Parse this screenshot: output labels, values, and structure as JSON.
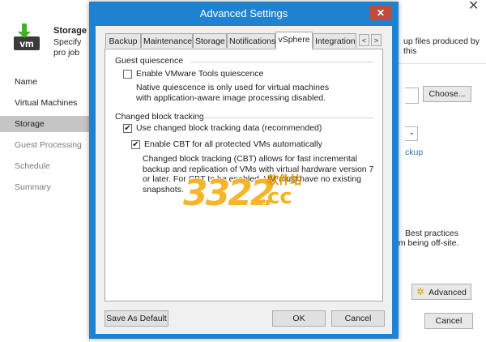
{
  "wizard": {
    "title": "Storage",
    "description_left": "Specify pro job and cu",
    "description_right": "up files produced by this",
    "close_glyph": "✕",
    "nav": [
      {
        "label": "Name",
        "state": "normal"
      },
      {
        "label": "Virtual Machines",
        "state": "normal"
      },
      {
        "label": "Storage",
        "state": "active"
      },
      {
        "label": "Guest Processing",
        "state": "dim"
      },
      {
        "label": "Schedule",
        "state": "dim"
      },
      {
        "label": "Summary",
        "state": "dim"
      }
    ],
    "choose_label": "Choose...",
    "link_fragment": "ckup",
    "note_line1": "Best practices",
    "note_line2": "em being off-site.",
    "advanced_label": "Advanced",
    "cancel_label": "Cancel",
    "icon": "vm-wizard-icon",
    "icon_text": "vm",
    "colors": {
      "nav_active": "#c5c5c5",
      "link": "#2a6fc0"
    }
  },
  "dialog": {
    "title": "Advanced Settings",
    "close_glyph": "✕",
    "tabs": [
      "Backup",
      "Maintenance",
      "Storage",
      "Notifications",
      "vSphere",
      "Integration"
    ],
    "active_tab": "vSphere",
    "tab_scroll_left": "<",
    "tab_scroll_right": ">",
    "guest_quiescence": {
      "heading": "Guest quiescence",
      "checkbox_label": "Enable VMware Tools quiescence",
      "checked": false,
      "help": "Native quiescence is only used for virtual machines with application-aware image processing disabled."
    },
    "cbt": {
      "heading": "Changed block tracking",
      "use_cbt_label": "Use changed block tracking data (recommended)",
      "use_cbt_checked": true,
      "enable_cbt_label": "Enable CBT for all protected VMs automatically",
      "enable_cbt_checked": true,
      "help": "Changed block tracking (CBT) allows for fast incremental backup and replication of VMs with virtual hardware version 7 or later. For CBT to be enabled, VM must have no existing snapshots."
    },
    "buttons": {
      "save_default": "Save As Default",
      "ok": "OK",
      "cancel": "Cancel"
    },
    "colors": {
      "titlebar": "#1e82d0",
      "close": "#c44a3c"
    }
  },
  "watermark": {
    "digits": "3322",
    "suffix": ".cc",
    "cn": "软件站"
  }
}
